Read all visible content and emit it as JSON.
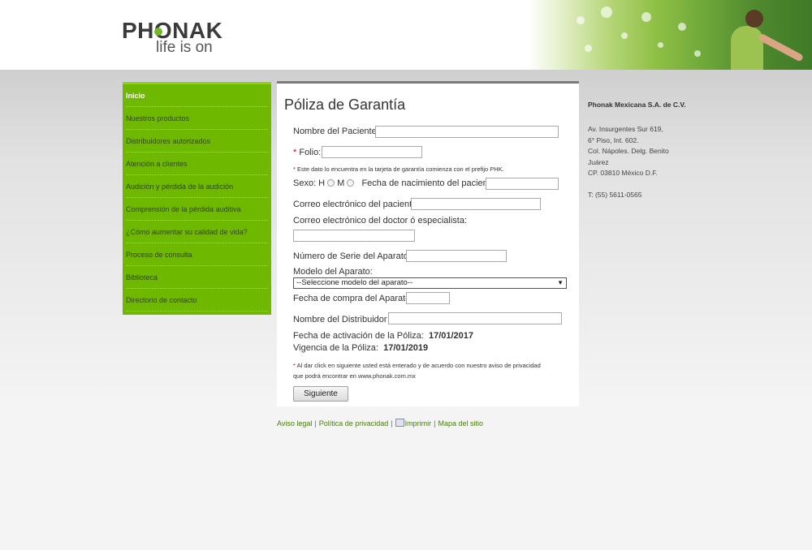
{
  "header": {
    "logo_word": "PHONAK",
    "logo_tagline": "life is on"
  },
  "colors": {
    "brand_green": "#6fb800",
    "link_green": "#4a7a10",
    "required_red": "#cc0000"
  },
  "sidebar": {
    "items": [
      {
        "label": "Inicio",
        "active": true
      },
      {
        "label": "Nuestros productos"
      },
      {
        "label": "Distribuidores autorizados"
      },
      {
        "label": "Atención a clientes"
      },
      {
        "label": "Audición y pérdida de la audición"
      },
      {
        "label": "Comprensión de la pérdida auditiva"
      },
      {
        "label": "¿Cómo aumentar su calidad de vida?"
      },
      {
        "label": "Proceso de consulta"
      },
      {
        "label": "Biblioteca"
      },
      {
        "label": "Directorio de contacto"
      }
    ]
  },
  "form": {
    "title": "Póliza de Garantía",
    "patient_name_label": "Nombre del Paciente:",
    "folio_label": "Folio:",
    "required_mark": "*",
    "folio_note": "Este dato lo encuentra en la tarjeta de garantía comienza con el prefijo PHK.",
    "sex_label": "Sexo: H",
    "sex_m_label": "M",
    "birthdate_label": "Fecha de nacimiento del paciente:",
    "patient_email_label": "Correo electrónico del paciente:",
    "doctor_email_label": "Correo electrónico del doctor ó especialista:",
    "serial_label": "Número de Serie del Aparato:",
    "model_label": "Modelo del Aparato:",
    "model_selected": "--Seleccione modelo del aparato--",
    "purchase_date_label": "Fecha de compra del Aparato:",
    "distributor_label": "Nombre del Distribuidor :",
    "activation_label": "Fecha de activación de la Póliza:",
    "activation_value": "17/01/2017",
    "validity_label": "Vigencia de la Póliza:",
    "validity_value": "17/01/2019",
    "privacy_note_1": "Al dar click en siguiente usted está enterado y de acuerdo con nuestro aviso de privacidad",
    "privacy_note_2": "que podrá encontrar en www.phonak.com.mx",
    "submit_label": "Siguiente"
  },
  "company": {
    "name": "Phonak Mexicana S.A. de C.V.",
    "address_lines": [
      "Av. Insurgentes Sur 619,",
      "6° Piso, Int. 602.",
      "Col. Nápoles. Delg. Benito",
      "Juárez",
      "CP. 03810 México D.F."
    ],
    "phone": "T: (55) 5611-0565"
  },
  "footer": {
    "legal": "Aviso legal",
    "privacy": "Política de privacidad",
    "print": "Imprimir",
    "sitemap": "Mapa del sitio",
    "separator": "|"
  }
}
